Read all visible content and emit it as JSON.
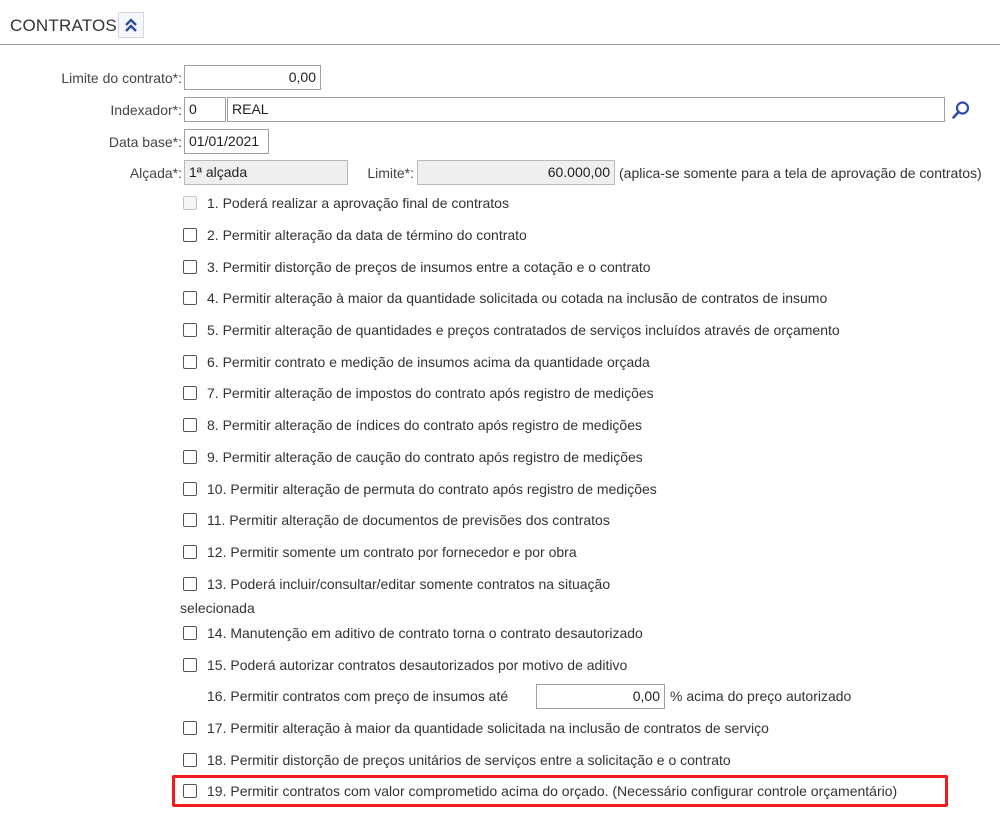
{
  "header": {
    "title": "CONTRATOS",
    "collapse_icon": "double-chevron-up-icon",
    "accent_color": "#2b4fa3"
  },
  "form": {
    "limite_contrato": {
      "label": "Limite do contrato*:",
      "value": "0,00"
    },
    "indexador": {
      "label": "Indexador*:",
      "code": "0",
      "description": "REAL",
      "search_icon": "search-icon"
    },
    "data_base": {
      "label": "Data base*:",
      "value": "01/01/2021"
    },
    "alcada": {
      "label": "Alçada*:",
      "value": "1ª alçada"
    },
    "limite": {
      "label": "Limite*:",
      "value": "60.000,00",
      "note": "(aplica-se somente para a tela de aprovação de contratos)"
    }
  },
  "permissions": [
    {
      "label": "1. Poderá realizar a aprovação final de contratos",
      "checked": false,
      "disabled": true
    },
    {
      "label": "2. Permitir alteração da data de término do contrato",
      "checked": false
    },
    {
      "label": "3. Permitir distorção de preços de insumos entre a cotação e o contrato",
      "checked": false
    },
    {
      "label": "4. Permitir alteração à maior da quantidade solicitada ou cotada na inclusão de contratos de insumo",
      "checked": false
    },
    {
      "label": "5. Permitir alteração de quantidades e preços contratados de serviços incluídos através de orçamento",
      "checked": false
    },
    {
      "label": "6. Permitir contrato e medição de insumos acima da quantidade orçada",
      "checked": false
    },
    {
      "label": "7. Permitir alteração de impostos do contrato após registro de medições",
      "checked": false
    },
    {
      "label": "8. Permitir alteração de índices do contrato após registro de medições",
      "checked": false
    },
    {
      "label": "9. Permitir alteração de caução do contrato após registro de medições",
      "checked": false
    },
    {
      "label": "10. Permitir alteração de permuta do contrato após registro de medições",
      "checked": false
    },
    {
      "label": "11. Permitir alteração de documentos de previsões dos contratos",
      "checked": false
    },
    {
      "label": "12. Permitir somente um contrato por fornecedor e por obra",
      "checked": false
    },
    {
      "label": "13. Poderá incluir/consultar/editar somente contratos na situação",
      "label_cont": "selecionada",
      "checked": false
    },
    {
      "label": "14. Manutenção em aditivo de contrato torna o contrato desautorizado",
      "checked": false
    },
    {
      "label": "15. Poderá autorizar contratos desautorizados por motivo de aditivo",
      "checked": false
    }
  ],
  "item16": {
    "label": "16. Permitir contratos com preço de insumos até",
    "value": "0,00",
    "suffix": "% acima do preço autorizado"
  },
  "permissions_b": [
    {
      "label": "17. Permitir alteração à maior da quantidade solicitada na inclusão de contratos de serviço",
      "checked": false
    },
    {
      "label": "18. Permitir distorção de preços unitários de serviços entre a solicitação e o contrato",
      "checked": false
    },
    {
      "label": "19. Permitir contratos com valor comprometido acima do orçado. (Necessário configurar controle orçamentário)",
      "checked": false,
      "highlight_color": "#ee1c1c"
    }
  ]
}
